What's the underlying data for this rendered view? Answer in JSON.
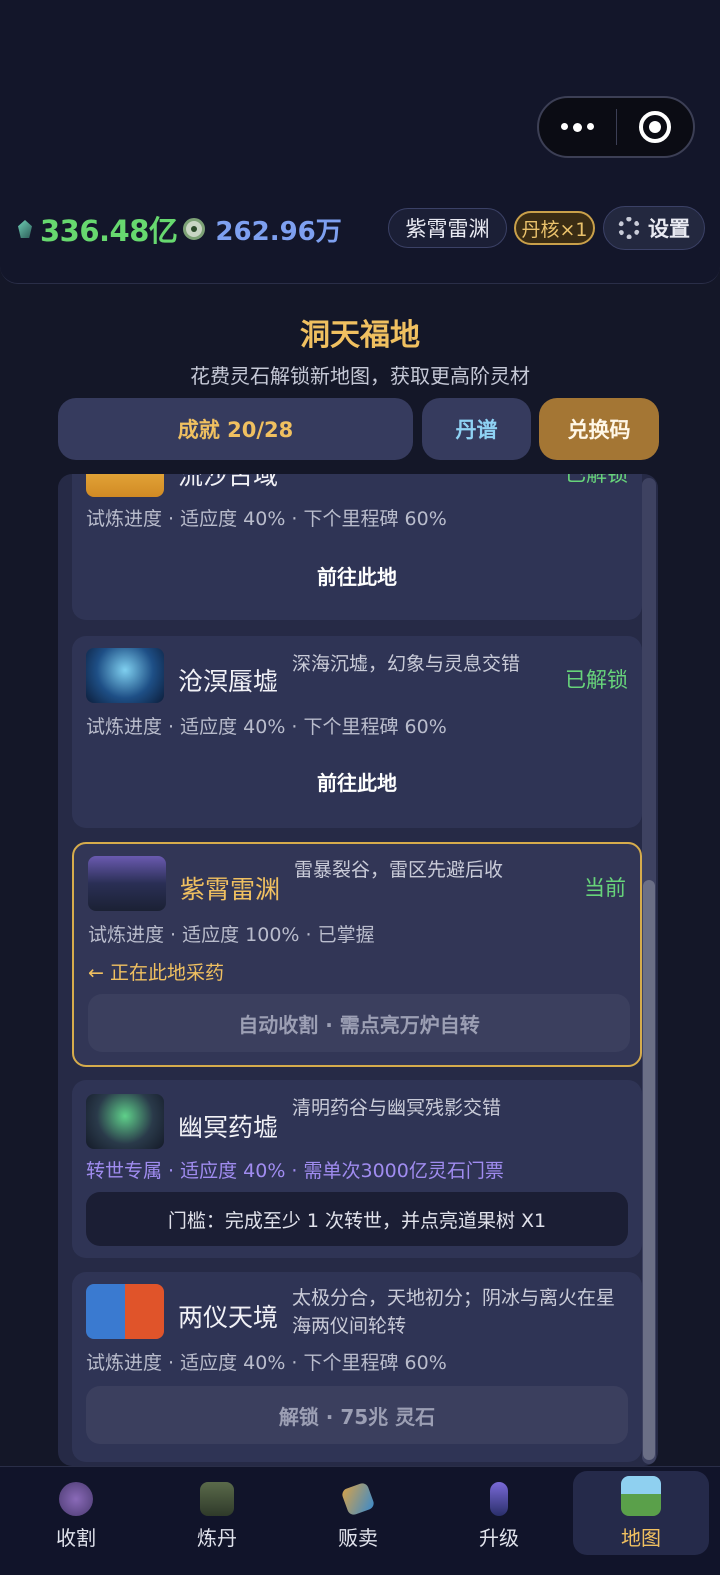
{
  "header": {
    "spirit_stone": "336.48亿",
    "essence": "262.96万",
    "current_map_chip": "紫霄雷渊",
    "core_chip": "丹核×1",
    "settings_label": "设置"
  },
  "page": {
    "title": "洞天福地",
    "subtitle": "花费灵石解锁新地图，获取更高阶灵材"
  },
  "buttons": {
    "achievement": "成就 20/28",
    "recipe": "丹谱",
    "redeem": "兑换码"
  },
  "cards": [
    {
      "name": "流沙古域",
      "status": "已解锁",
      "meta": "试炼进度 · 适应度 40% · 下个里程碑 60%",
      "action": "前往此地"
    },
    {
      "name": "沧溟蜃墟",
      "desc": "深海沉墟，幻象与灵息交错",
      "status": "已解锁",
      "meta": "试炼进度 · 适应度 40% · 下个里程碑 60%",
      "action": "前往此地"
    },
    {
      "name": "紫霄雷渊",
      "desc": "雷暴裂谷，雷区先避后收",
      "status": "当前",
      "meta": "试炼进度 · 适应度 100% · 已掌握",
      "here": "← 正在此地采药",
      "action": "自动收割 · 需点亮万炉自转"
    },
    {
      "name": "幽冥药墟",
      "desc": "清明药谷与幽冥残影交错",
      "meta": "转世专属 · 适应度 40% · 需单次3000亿灵石门票",
      "action": "门槛：完成至少 1 次转世，并点亮道果树 X1"
    },
    {
      "name": "两仪天境",
      "desc": "太极分合，天地初分；阴冰与离火在星海两仪间轮转",
      "meta": "试炼进度 · 适应度 40% · 下个里程碑 60%",
      "action": "解锁 · 75兆 灵石"
    }
  ],
  "nav": [
    {
      "label": "收割"
    },
    {
      "label": "炼丹"
    },
    {
      "label": "贩卖"
    },
    {
      "label": "升级"
    },
    {
      "label": "地图"
    }
  ],
  "colors": {
    "accent_gold": "#f0c060",
    "unlocked_green": "#67d47a",
    "stone_green": "#67d86f",
    "essence_blue": "#7ea0f0"
  }
}
